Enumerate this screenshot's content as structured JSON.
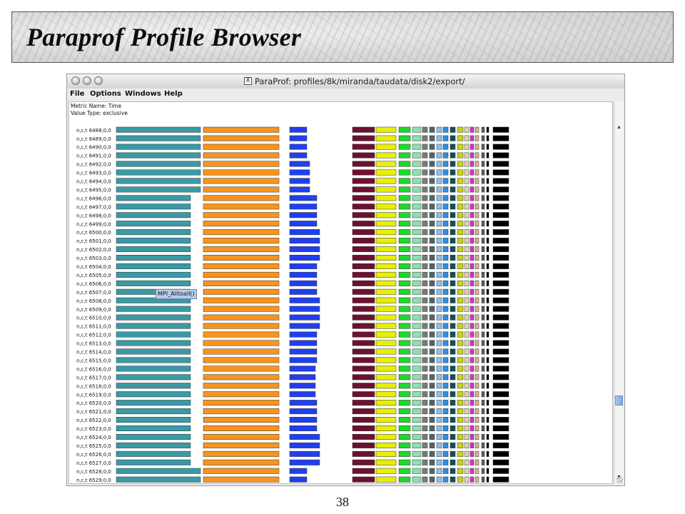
{
  "slide": {
    "title": "Paraprof Profile Browser",
    "page_number": "38"
  },
  "window": {
    "title": "ParaProf: profiles/8k/miranda/taudata/disk2/export/",
    "menu": [
      "File",
      "Options",
      "Windows",
      "Help"
    ],
    "metric_name": "Metric Name: Time",
    "value_type": "Value Type: exclusive",
    "tooltip": "MPI_Alltoall()",
    "scroll_up_symbol": "▲",
    "scroll_down_symbol": "▼"
  },
  "rows": [
    "n,c,t 6488,0,0",
    "n,c,t 6489,0,0",
    "n,c,t 6490,0,0",
    "n,c,t 6491,0,0",
    "n,c,t 6492,0,0",
    "n,c,t 6493,0,0",
    "n,c,t 6494,0,0",
    "n,c,t 6495,0,0",
    "n,c,t 6496,0,0",
    "n,c,t 6497,0,0",
    "n,c,t 6498,0,0",
    "n,c,t 6499,0,0",
    "n,c,t 6500,0,0",
    "n,c,t 6501,0,0",
    "n,c,t 6502,0,0",
    "n,c,t 6503,0,0",
    "n,c,t 6504,0,0",
    "n,c,t 6505,0,0",
    "n,c,t 6506,0,0",
    "n,c,t 6507,0,0",
    "n,c,t 6508,0,0",
    "n,c,t 6509,0,0",
    "n,c,t 6510,0,0",
    "n,c,t 6511,0,0",
    "n,c,t 6512,0,0",
    "n,c,t 6513,0,0",
    "n,c,t 6514,0,0",
    "n,c,t 6515,0,0",
    "n,c,t 6516,0,0",
    "n,c,t 6517,0,0",
    "n,c,t 6518,0,0",
    "n,c,t 6519,0,0",
    "n,c,t 6520,0,0",
    "n,c,t 6521,0,0",
    "n,c,t 6522,0,0",
    "n,c,t 6523,0,0",
    "n,c,t 6524,0,0",
    "n,c,t 6525,0,0",
    "n,c,t 6526,0,0",
    "n,c,t 6527,0,0",
    "n,c,t 6528,0,0",
    "n,c,t 6529,0,0"
  ],
  "colors": {
    "teal": "#3a9aa5",
    "orange": "#f7941d",
    "blue": "#1f3ff0",
    "maroon": "#6e1030",
    "yellow": "#e6f000",
    "green": "#1fd82c",
    "mint": "#8fe0b0",
    "gray": "#7a7a7a",
    "slate": "#4d6670",
    "lightblue": "#8fbff0",
    "skyblue": "#2d8fe0",
    "darkteal": "#0f4f5a",
    "olive": "#c8d21e",
    "pale": "#d8d8b0",
    "magenta": "#e02cc8",
    "tan": "#d2b48c",
    "dim": "#5a5a5a",
    "black": "#000000"
  }
}
